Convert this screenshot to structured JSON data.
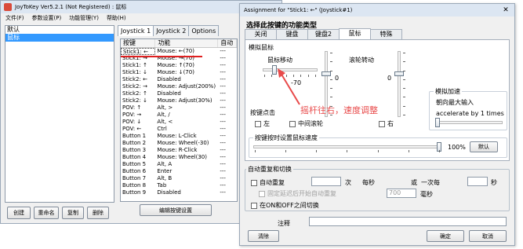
{
  "main_window": {
    "title": "JoyToKey Ver5.2.1 (Not Registered) : 鼠标",
    "menu": [
      "文件(F)",
      "参数设置(P)",
      "功能管理(Y)",
      "帮助(H)"
    ],
    "configs": [
      "默认",
      "鼠标"
    ],
    "buttons": {
      "create": "创建",
      "rename": "重命名",
      "copy": "复制",
      "delete": "删除"
    },
    "tabs": [
      "Joystick 1",
      "Joystick 2",
      "Options"
    ],
    "columns": [
      "按键",
      "功能",
      "自动"
    ],
    "rows": [
      [
        "Stick1: ←",
        "Mouse: ←(70)",
        "---"
      ],
      [
        "Stick1: →",
        "Mouse: →(70)",
        "---"
      ],
      [
        "Stick1: ↑",
        "Mouse: ↑(70)",
        "---"
      ],
      [
        "Stick1: ↓",
        "Mouse: ↓(70)",
        "---"
      ],
      [
        "Stick2: ←",
        "Disabled",
        "---"
      ],
      [
        "Stick2: →",
        "Mouse: Adjust(200%)",
        "---"
      ],
      [
        "Stick2: ↑",
        "Disabled",
        "---"
      ],
      [
        "Stick2: ↓",
        "Mouse: Adjust(30%)",
        "---"
      ],
      [
        "POV: ↑",
        "Alt, >",
        "---"
      ],
      [
        "POV: →",
        "Alt, /",
        "---"
      ],
      [
        "POV: ↓",
        "Alt, <",
        "---"
      ],
      [
        "POV: ←",
        "Ctrl",
        "---"
      ],
      [
        "Button 1",
        "Mouse: L-Click",
        "---"
      ],
      [
        "Button 2",
        "Mouse: Wheel(-30)",
        "---"
      ],
      [
        "Button 3",
        "Mouse: R-Click",
        "---"
      ],
      [
        "Button 4",
        "Mouse: Wheel(30)",
        "---"
      ],
      [
        "Button 5",
        "Alt, A",
        "---"
      ],
      [
        "Button 6",
        "Enter",
        "---"
      ],
      [
        "Button 7",
        "Alt, B",
        "---"
      ],
      [
        "Button 8",
        "Tab",
        "---"
      ],
      [
        "Button 9",
        "Disabled",
        "---"
      ]
    ],
    "edit_button": "编辑按键设置"
  },
  "dialog": {
    "title": "Assignment for \"Stick1: ←\" (Joystick#1)",
    "subtitle": "选择此按键的功能类型",
    "tabs": [
      "关闭",
      "键盘",
      "键盘2",
      "鼠标",
      "特殊"
    ],
    "active_tab": "鼠标",
    "mouse_group": "模拟鼠标",
    "mouse_move_label": "鼠标移动",
    "mouse_move_value": "-70",
    "vertical_move_value": "0",
    "wheel_label": "滚轮转动",
    "wheel_value": "0",
    "accel_group": "模拟加速",
    "accel_text1": "朝向最大输入",
    "accel_text2": "accelerate by 1 times",
    "click_group": "按键点击",
    "click_left": "左",
    "click_middle": "中间滚轮",
    "click_right": "右",
    "speed_group": "按键按时设置鼠标速度",
    "speed_value": "100%",
    "default_button": "默认",
    "auto_group": "自动重复和切换",
    "auto_repeat": "自动重复",
    "times_label": "次",
    "per_second": "每秒",
    "or_label": "或",
    "once_every": "一次每",
    "seconds_label": "秒",
    "fixed_delay": "固定延迟后开始自动重复",
    "delay_value": "700",
    "ms_label": "毫秒",
    "toggle_onoff": "在ON和OFF之间切换",
    "comment_label": "注释",
    "clear_button": "清除",
    "ok_button": "确定",
    "cancel_button": "取消"
  },
  "annotation": "摇杆往右，速度调整",
  "colors": {
    "annotation": "#e84a4a",
    "underline": "#e02020",
    "selection": "#3399ff"
  }
}
